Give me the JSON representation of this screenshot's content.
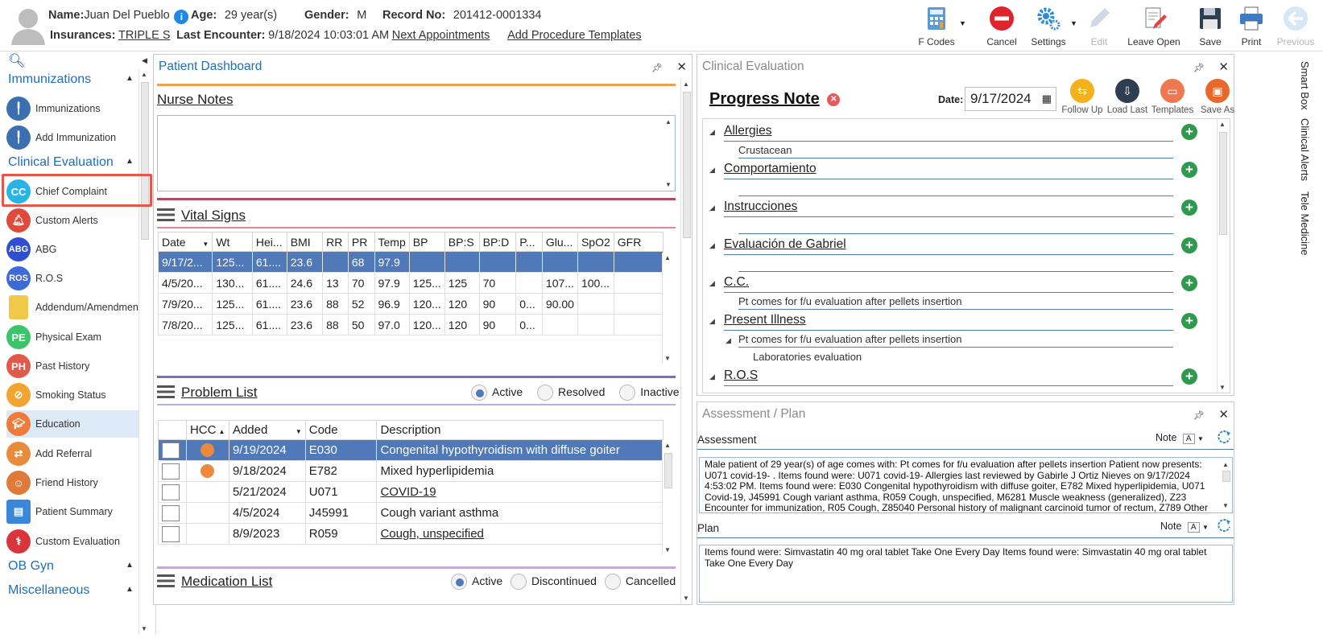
{
  "header": {
    "name_label": "Name:",
    "name_value": "Juan Del Pueblo",
    "age_label": "Age:",
    "age_value": "29 year(s)",
    "gender_label": "Gender:",
    "gender_value": "M",
    "record_label": "Record No:",
    "record_value": "201412-0001334",
    "insurances_label": "Insurances:",
    "insurances_value": "TRIPLE S",
    "last_encounter_label": "Last Encounter:",
    "last_encounter_value": "9/18/2024 10:03:01 AM",
    "next_appointments": "Next Appointments",
    "add_procedure_templates": "Add Procedure Templates"
  },
  "toolbar": {
    "fcodes": "F Codes",
    "cancel": "Cancel",
    "settings": "Settings",
    "edit": "Edit",
    "leave_open": "Leave Open",
    "save": "Save",
    "print": "Print",
    "previous": "Previous"
  },
  "leftnav": {
    "sections": {
      "immunizations": "Immunizations",
      "clinical_evaluation": "Clinical Evaluation",
      "ob_gyn": "OB Gyn",
      "miscellaneous": "Miscellaneous"
    },
    "items": [
      {
        "label": "Immunizations",
        "icon": "syringe-icon",
        "color": "#3b6fb0"
      },
      {
        "label": "Add Immunization",
        "icon": "syringe-add-icon",
        "color": "#3b6fb0"
      },
      {
        "label": "Chief Complaint",
        "icon": "cc-icon",
        "color": "#27b5e8",
        "badge": "CC"
      },
      {
        "label": "Custom Alerts",
        "icon": "bell-icon",
        "color": "#e04a3b"
      },
      {
        "label": "ABG",
        "icon": "abg-icon",
        "color": "#2f4fd0",
        "badge": "ABG"
      },
      {
        "label": "R.O.S",
        "icon": "ros-icon",
        "color": "#3c6ad6",
        "badge": "ROS"
      },
      {
        "label": "Addendum/Amendments",
        "icon": "note-icon",
        "color": "#f0c94a"
      },
      {
        "label": "Physical Exam",
        "icon": "pe-icon",
        "color": "#3cc46a",
        "badge": "PE"
      },
      {
        "label": "Past History",
        "icon": "ph-icon",
        "color": "#e05a4a",
        "badge": "PH"
      },
      {
        "label": "Smoking Status",
        "icon": "no-smoking-icon",
        "color": "#f2a431"
      },
      {
        "label": "Education",
        "icon": "education-icon",
        "color": "#f07a3a"
      },
      {
        "label": "Add Referral",
        "icon": "referral-icon",
        "color": "#e88b3a"
      },
      {
        "label": "Friend History",
        "icon": "friends-icon",
        "color": "#e07a3a"
      },
      {
        "label": "Patient Summary",
        "icon": "summary-icon",
        "color": "#3a86d9"
      },
      {
        "label": "Custom Evaluation",
        "icon": "stethoscope-icon",
        "color": "#d9363b"
      }
    ]
  },
  "dashboard": {
    "title": "Patient Dashboard",
    "nurse_notes": "Nurse Notes",
    "vital_signs": "Vital Signs",
    "vital_columns": [
      "Date",
      "Wt",
      "Hei...",
      "BMI",
      "RR",
      "PR",
      "Temp",
      "BP",
      "BP:S",
      "BP:D",
      "P...",
      "Glu...",
      "SpO2",
      "GFR"
    ],
    "vital_rows": [
      [
        "9/17/2...",
        "125...",
        "61....",
        "23.6",
        "",
        "68",
        "97.9",
        "",
        "",
        "",
        "",
        "",
        "",
        ""
      ],
      [
        "4/5/20...",
        "130...",
        "61....",
        "24.6",
        "13",
        "70",
        "97.9",
        "125...",
        "125",
        "70",
        "",
        "107...",
        "100...",
        ""
      ],
      [
        "7/9/20...",
        "125...",
        "61....",
        "23.6",
        "88",
        "52",
        "96.9",
        "120...",
        "120",
        "90",
        "0...",
        "90.00",
        "",
        ""
      ],
      [
        "7/8/20...",
        "125...",
        "61....",
        "23.6",
        "88",
        "50",
        "97.0",
        "120...",
        "120",
        "90",
        "0...",
        "",
        "",
        ""
      ]
    ],
    "problem_list": "Problem List",
    "problem_filters": [
      "Active",
      "Resolved",
      "Inactive"
    ],
    "problem_columns": [
      "",
      "HCC",
      "Added",
      "Code",
      "Description"
    ],
    "problem_rows": [
      {
        "hcc": true,
        "added": "9/19/2024",
        "code": "E030",
        "description": "Congenital hypothyroidism with diffuse goiter",
        "link": false
      },
      {
        "hcc": true,
        "added": "9/18/2024",
        "code": "E782",
        "description": "Mixed hyperlipidemia",
        "link": false
      },
      {
        "hcc": false,
        "added": "5/21/2024",
        "code": "U071",
        "description": "COVID-19",
        "link": true
      },
      {
        "hcc": false,
        "added": "4/5/2024",
        "code": "J45991",
        "description": "Cough variant asthma",
        "link": false
      },
      {
        "hcc": false,
        "added": "8/9/2023",
        "code": "R059",
        "description": "Cough, unspecified",
        "link": true
      }
    ],
    "medication_list": "Medication List",
    "medication_filters": [
      "Active",
      "Discontinued",
      "Cancelled"
    ]
  },
  "clinical": {
    "title": "Clinical Evaluation",
    "progress_note": "Progress Note",
    "date_label": "Date:",
    "date_value": "9/17/2024",
    "tools": [
      "Follow Up",
      "Load Last",
      "Templates",
      "Save As"
    ],
    "sections": {
      "allergies": "Allergies",
      "allergies_value": "Crustacean",
      "comportamiento": "Comportamiento",
      "instrucciones": "Instrucciones",
      "evaluacion": "Evaluación de Gabriel",
      "cc": "C.C.",
      "cc_value": "Pt comes for f/u evaluation after pellets insertion",
      "present_illness": "Present Illness",
      "pi_value": "Pt comes for f/u evaluation after pellets insertion",
      "pi_sub": "Laboratories evaluation",
      "ros": "R.O.S"
    }
  },
  "assessment": {
    "title": "Assessment / Plan",
    "assessment_label": "Assessment",
    "note_label": "Note",
    "assessment_text": "Male patient of 29 year(s) of age comes with:  Pt comes for f/u evaluation after pellets insertion  Patient now presents: U071 covid-19- . Items found were:  U071 covid-19-    Allergies last reviewed by Gabirle J Ortiz Nieves on 9/17/2024 4:53:02 PM.    Items found were:  E030 Congenital hypothyroidism with diffuse goiter, E782 Mixed hyperlipidemia, U071 Covid-19, J45991 Cough variant asthma, R059 Cough, unspecified, M6281 Muscle weakness (generalized), Z23 Encounter for immunization, R05 Cough, Z85040 Personal history of malignant carcinoid tumor of rectum, Z789 Other",
    "plan_label": "Plan",
    "plan_text": "  Items found were:  Simvastatin 40 mg oral tablet Take One Every Day   Items found were:  Simvastatin 40 mg oral tablet Take One Every Day"
  },
  "side_tabs": [
    "Smart Box",
    "Clinical Alerts",
    "Tele Medicine"
  ]
}
